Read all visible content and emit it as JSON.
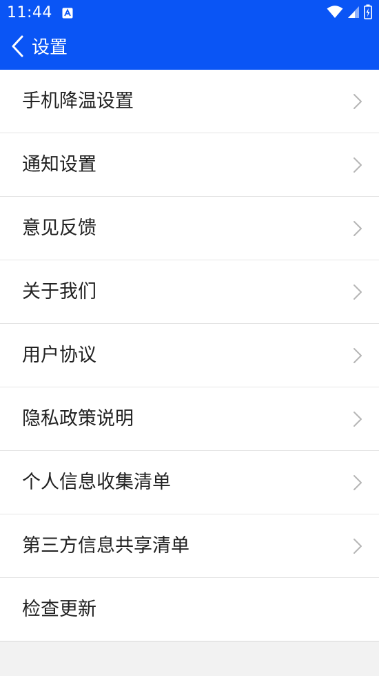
{
  "status_bar": {
    "time": "11:44",
    "app_icon": "a-notification-icon",
    "icons": [
      "wifi-icon",
      "cell-signal-icon",
      "battery-charging-icon"
    ]
  },
  "header": {
    "back_icon": "back-chevron-icon",
    "title": "设置"
  },
  "settings": {
    "items": [
      {
        "label": "手机降温设置",
        "has_arrow": true
      },
      {
        "label": "通知设置",
        "has_arrow": true
      },
      {
        "label": "意见反馈",
        "has_arrow": true
      },
      {
        "label": "关于我们",
        "has_arrow": true
      },
      {
        "label": "用户协议",
        "has_arrow": true
      },
      {
        "label": "隐私政策说明",
        "has_arrow": true
      },
      {
        "label": "个人信息收集清单",
        "has_arrow": true
      },
      {
        "label": "第三方信息共享清单",
        "has_arrow": true
      },
      {
        "label": "检查更新",
        "has_arrow": false
      }
    ]
  },
  "colors": {
    "primary": "#0a55f5",
    "background": "#f2f2f2",
    "list_background": "#ffffff",
    "text": "#222222",
    "chevron": "#b5b5b5",
    "divider": "#e4e4e4"
  }
}
